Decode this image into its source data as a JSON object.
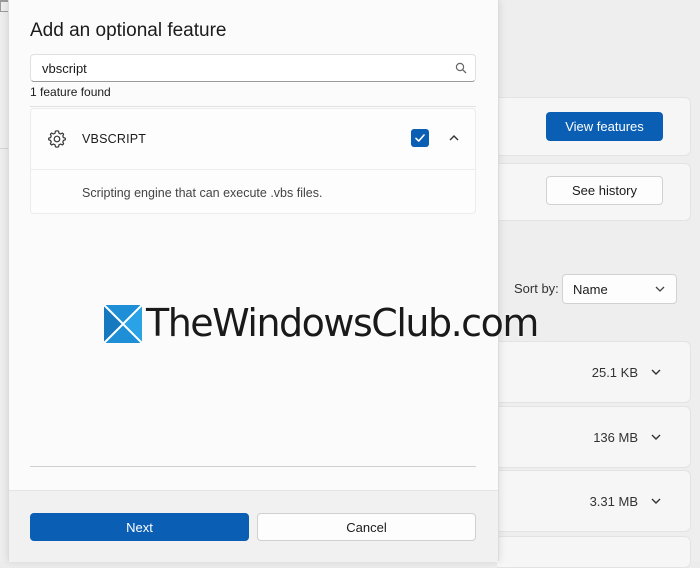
{
  "background": {
    "view_features_label": "View features",
    "see_history_label": "See history",
    "sort_label": "Sort by:",
    "sort_value": "Name",
    "installed_sizes": [
      "25.1 KB",
      "136 MB",
      "3.31 MB"
    ]
  },
  "dialog": {
    "title": "Add an optional feature",
    "search": {
      "value": "vbscript",
      "placeholder": ""
    },
    "result_count": "1 feature found",
    "feature": {
      "name": "VBSCRIPT",
      "checked": true,
      "description": "Scripting engine that can execute .vbs files."
    },
    "next_label": "Next",
    "cancel_label": "Cancel"
  },
  "watermark": {
    "text": "TheWindowsClub.com"
  },
  "icons": {
    "search": "search-icon",
    "gear": "gear-icon",
    "check": "checkmark-icon",
    "collapse": "chevron-up-icon",
    "expand": "chevron-down-icon"
  },
  "colors": {
    "accent": "#0a5fb4",
    "dialog_bg": "#fbfbfb",
    "footer_bg": "#f1f1f1"
  }
}
